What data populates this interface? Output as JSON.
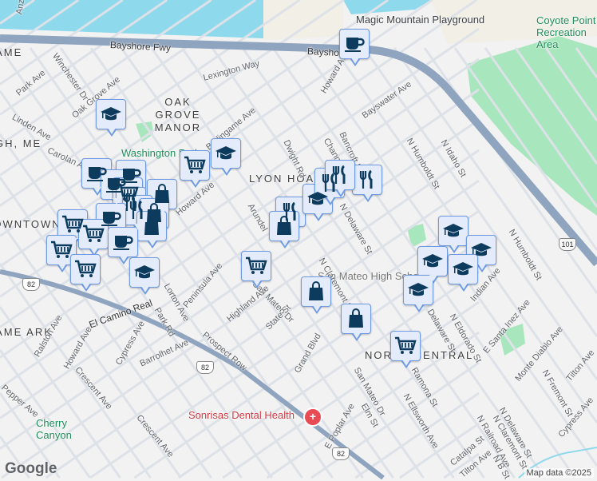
{
  "map": {
    "attribution": "Map data ©2025",
    "logo": "Google",
    "colors": {
      "water": "#8fd9ec",
      "park": "#a8e6bd",
      "freeway": "#8fa4be",
      "road": "#dde1e8",
      "marker_fill": "#e4ecfb",
      "marker_border": "#6d9ae3",
      "icon": "#0d3b5e",
      "dental": "#e94b55"
    },
    "pois": {
      "playground": "Magic Mountain Playground",
      "recreation": "Coyote Point Recreation Area",
      "park": "Washington Park",
      "canyon": "Cherry Canyon",
      "dental": "Sonrisas Dental Health",
      "school": "San Mateo High School"
    },
    "neighborhoods": {
      "oak_grove": "OAK GROVE MANOR",
      "lyon": "LYON HOAG",
      "north_central": "NORTH CENTRAL",
      "downtown": "DOWNTOWN",
      "left1": "GAME",
      "left2": "GH, ME",
      "left3": "GAME ARK"
    },
    "highways": {
      "bayshore": "Bayshore Fwy",
      "bayshore2": "Bayshore",
      "ecr": "El Camino Real",
      "s82a": "82",
      "s82b": "82",
      "s82c": "82",
      "s101": "101"
    },
    "streets": [
      "Winchester Dr",
      "Park Ave",
      "Lexington Way",
      "Oak Grove Ave",
      "Linden Ave",
      "Burlingame Ave",
      "Carolan Ave",
      "Howard Ave",
      "Howard Ave",
      "Bayswater Ave",
      "Bancroft Rd",
      "Channing",
      "Dwight Rd",
      "Arundel",
      "N Delaware St",
      "N Claremont St",
      "N Humboldt St",
      "N Idaho St",
      "Peninsula Ave",
      "San Mateo Dr",
      "San Mateo Dr",
      "Highland Ave",
      "State St",
      "Lorton Ave",
      "Park Rd",
      "Prospect Row",
      "Ralston Ave",
      "Howard Ave",
      "Cypress Ave",
      "Barrolhet Ave",
      "Crescent Ave",
      "Pepper Ave",
      "Crescent Ave",
      "Grand Blvd",
      "E Poplar Ave",
      "Elm St",
      "Ramona St",
      "N Ellsworth Ave",
      "Delaware St",
      "N Delaware St",
      "N Eldorado St",
      "Indian Ave",
      "E Santa Inez Ave",
      "Monte Diablo Ave",
      "N Fremont St",
      "Tilton Ave",
      "Cypress Ave",
      "Catalpa St",
      "N Railroad Ave",
      "N Claremont St",
      "Tilton Ave",
      "N B St",
      "N Humboldt St",
      "Anza"
    ],
    "markers": [
      "coffee",
      "school",
      "school",
      "cart",
      "coffee",
      "coffee",
      "coffee",
      "cart",
      "fork",
      "bag",
      "fork",
      "bag",
      "bag",
      "coffee",
      "cart",
      "cart",
      "cart",
      "coffee",
      "cart",
      "school",
      "cart",
      "bag",
      "bag",
      "cart",
      "fork",
      "bag",
      "school",
      "fork",
      "fork",
      "fork",
      "school",
      "school",
      "school",
      "school",
      "school"
    ]
  }
}
